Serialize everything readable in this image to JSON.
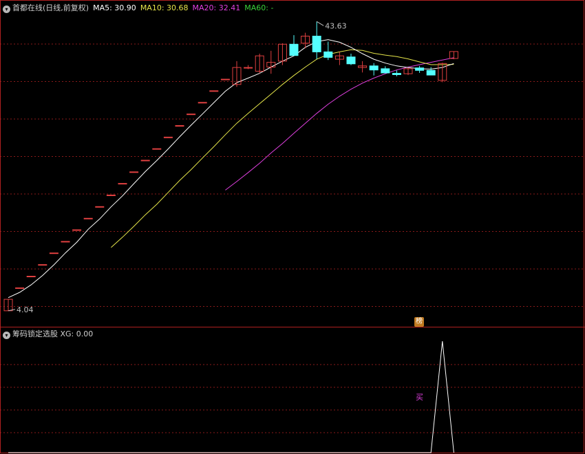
{
  "main_legend": {
    "title": "首都在线(日线,前复权)",
    "ma5_label": "MA5: 30.90",
    "ma10_label": "MA10: 30.68",
    "ma20_label": "MA20: 32.41",
    "ma60_label": "MA60: -"
  },
  "sub_legend": {
    "title": "筹码锁定选股",
    "xg_label": "XG: 0.00"
  },
  "annotations": {
    "high_label": "43.63",
    "low_label": "4.04",
    "badge_text": "榜",
    "buy_text": "买"
  },
  "colors": {
    "background": "#000000",
    "up": "#e04040",
    "down": "#54ffff",
    "grid": "#8b1a1a",
    "ma5": "#ffffff",
    "ma10": "#e6e64a",
    "ma20": "#e040e0",
    "ma60": "#3ad13a",
    "panel_border": "#b02020"
  },
  "chart_data": [
    {
      "type": "candlestick",
      "title": "首都在线(日线,前复权)",
      "scale": "log",
      "ylim": [
        3.9,
        46
      ],
      "x": [
        1,
        2,
        3,
        4,
        5,
        6,
        7,
        8,
        9,
        10,
        11,
        12,
        13,
        14,
        15,
        16,
        17,
        18,
        19,
        20,
        21,
        22,
        23,
        24,
        25,
        26,
        27,
        28,
        29,
        30,
        31,
        32,
        33,
        34,
        35,
        36,
        37
      ],
      "ohlc": [
        [
          4.04,
          4.44,
          4.04,
          4.44
        ],
        [
          4.88,
          4.88,
          4.88,
          4.88
        ],
        [
          5.37,
          5.37,
          5.37,
          5.37
        ],
        [
          5.91,
          5.91,
          5.91,
          5.91
        ],
        [
          6.5,
          6.5,
          6.5,
          6.5
        ],
        [
          7.15,
          7.15,
          7.15,
          7.15
        ],
        [
          7.87,
          7.87,
          7.87,
          7.87
        ],
        [
          8.65,
          8.65,
          8.65,
          8.65
        ],
        [
          9.52,
          9.52,
          9.52,
          9.52
        ],
        [
          10.47,
          10.47,
          10.47,
          10.47
        ],
        [
          11.52,
          11.52,
          11.52,
          11.52
        ],
        [
          12.67,
          12.67,
          12.67,
          12.67
        ],
        [
          13.94,
          13.94,
          13.94,
          13.94
        ],
        [
          15.33,
          15.33,
          15.33,
          15.33
        ],
        [
          16.86,
          16.86,
          16.86,
          16.86
        ],
        [
          18.55,
          18.55,
          18.55,
          18.55
        ],
        [
          20.4,
          20.4,
          20.4,
          20.4
        ],
        [
          22.44,
          22.44,
          22.44,
          22.44
        ],
        [
          24.69,
          24.69,
          24.69,
          24.69
        ],
        [
          27.16,
          27.16,
          27.16,
          27.16
        ],
        [
          26.0,
          31.5,
          25.5,
          29.9
        ],
        [
          29.9,
          30.5,
          29.5,
          29.9
        ],
        [
          29.0,
          33.5,
          28.5,
          32.9
        ],
        [
          30.0,
          34.3,
          28.4,
          31.2
        ],
        [
          31.5,
          36.5,
          30.5,
          36.2
        ],
        [
          36.2,
          39.0,
          33.0,
          33.0
        ],
        [
          36.5,
          39.8,
          35.0,
          38.7
        ],
        [
          38.7,
          43.63,
          32.0,
          34.0
        ],
        [
          34.0,
          37.0,
          31.8,
          32.5
        ],
        [
          32.0,
          34.0,
          30.5,
          32.9
        ],
        [
          32.6,
          33.5,
          30.5,
          30.8
        ],
        [
          29.9,
          31.5,
          28.7,
          30.3
        ],
        [
          30.3,
          31.0,
          28.0,
          29.3
        ],
        [
          29.6,
          30.2,
          28.5,
          28.6
        ],
        [
          28.5,
          29.2,
          27.8,
          28.2
        ],
        [
          28.4,
          29.8,
          28.1,
          29.6
        ],
        [
          29.8,
          30.3,
          28.6,
          29.2
        ],
        [
          29.2,
          30.0,
          28.3,
          28.1
        ],
        [
          26.9,
          31.1,
          26.5,
          30.9
        ],
        [
          32.2,
          34.1,
          32.0,
          34.1
        ]
      ],
      "ma5": [
        4.5,
        4.7,
        5.0,
        5.4,
        5.9,
        6.5,
        7.1,
        7.9,
        8.6,
        9.5,
        10.4,
        11.5,
        12.7,
        13.9,
        15.3,
        16.9,
        18.6,
        20.4,
        22.4,
        24.6,
        26.4,
        27.4,
        28.5,
        30.0,
        31.5,
        32.9,
        35.3,
        37.0,
        37.6,
        36.8,
        35.3,
        33.5,
        32.0,
        31.0,
        30.3,
        29.9,
        29.6,
        29.5,
        29.9,
        30.9
      ],
      "ma10": [
        null,
        null,
        null,
        null,
        null,
        null,
        null,
        null,
        null,
        6.8,
        7.4,
        8.1,
        8.9,
        9.7,
        10.7,
        11.8,
        12.9,
        14.2,
        15.6,
        17.2,
        18.9,
        20.5,
        22.2,
        24.0,
        26.0,
        28.0,
        30.0,
        32.0,
        33.3,
        34.0,
        34.6,
        34.4,
        33.6,
        33.1,
        32.7,
        32.1,
        31.3,
        30.6,
        30.6,
        30.68
      ],
      "ma20": [
        null,
        null,
        null,
        null,
        null,
        null,
        null,
        null,
        null,
        null,
        null,
        null,
        null,
        null,
        null,
        null,
        null,
        null,
        null,
        10.9,
        11.7,
        12.6,
        13.6,
        14.8,
        16.0,
        17.4,
        18.9,
        20.5,
        22.1,
        23.6,
        25.0,
        26.3,
        27.4,
        28.4,
        29.3,
        30.0,
        30.6,
        31.2,
        31.8,
        32.41
      ],
      "ma60": []
    },
    {
      "type": "line",
      "title": "筹码锁定选股",
      "series": [
        {
          "name": "XG",
          "values": [
            0,
            0,
            0,
            0,
            0,
            0,
            0,
            0,
            0,
            0,
            0,
            0,
            0,
            0,
            0,
            0,
            0,
            0,
            0,
            0,
            0,
            0,
            0,
            0,
            0,
            0,
            0,
            0,
            0,
            0,
            0,
            0,
            0,
            0,
            0,
            0,
            0,
            0,
            1,
            0
          ]
        }
      ],
      "ylim": [
        0,
        1.2
      ]
    }
  ]
}
